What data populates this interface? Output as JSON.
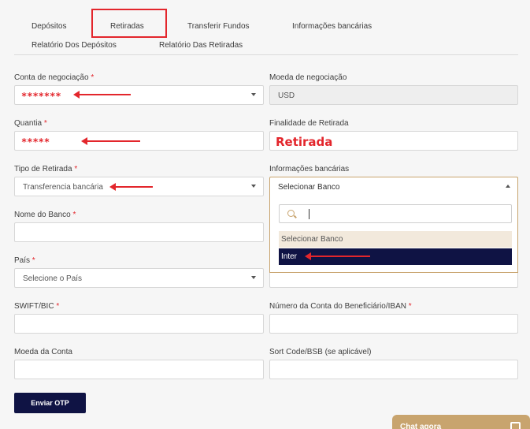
{
  "tabs": {
    "depositos": "Depósitos",
    "retiradas": "Retiradas",
    "transferir": "Transferir Fundos",
    "informacoes": "Informações bancárias",
    "relatorio_depositos": "Relatório Dos Depósitos",
    "relatorio_retiradas": "Relatório Das Retiradas"
  },
  "form": {
    "conta_label": "Conta de negociação",
    "conta_value": "*******",
    "moeda_neg_label": "Moeda de negociação",
    "moeda_neg_value": "USD",
    "quantia_label": "Quantia",
    "quantia_value": "*****",
    "finalidade_label": "Finalidade de Retirada",
    "finalidade_value": "Retirada",
    "tipo_label": "Tipo de Retirada",
    "tipo_value": "Transferencia bancária",
    "info_label": "Informações bancárias",
    "info_value": "Selecionar Banco",
    "banco_label": "Nome do Banco",
    "pais_label": "País",
    "pais_value": "Selecione o País",
    "swift_label": "SWIFT/BIC",
    "iban_label": "Número da Conta do Beneficiário/IBAN",
    "moeda_conta_label": "Moeda da Conta",
    "sort_label": "Sort Code/BSB (se aplicável)",
    "required": "*"
  },
  "dropdown": {
    "search_value": "",
    "options": [
      "Selecionar Banco",
      "Inter"
    ]
  },
  "actions": {
    "otp_button": "Enviar OTP"
  },
  "chat": {
    "label": "Chat agora"
  },
  "colors": {
    "accent_red": "#e3262c",
    "navy": "#0f1344",
    "gold": "#c8a46e"
  }
}
